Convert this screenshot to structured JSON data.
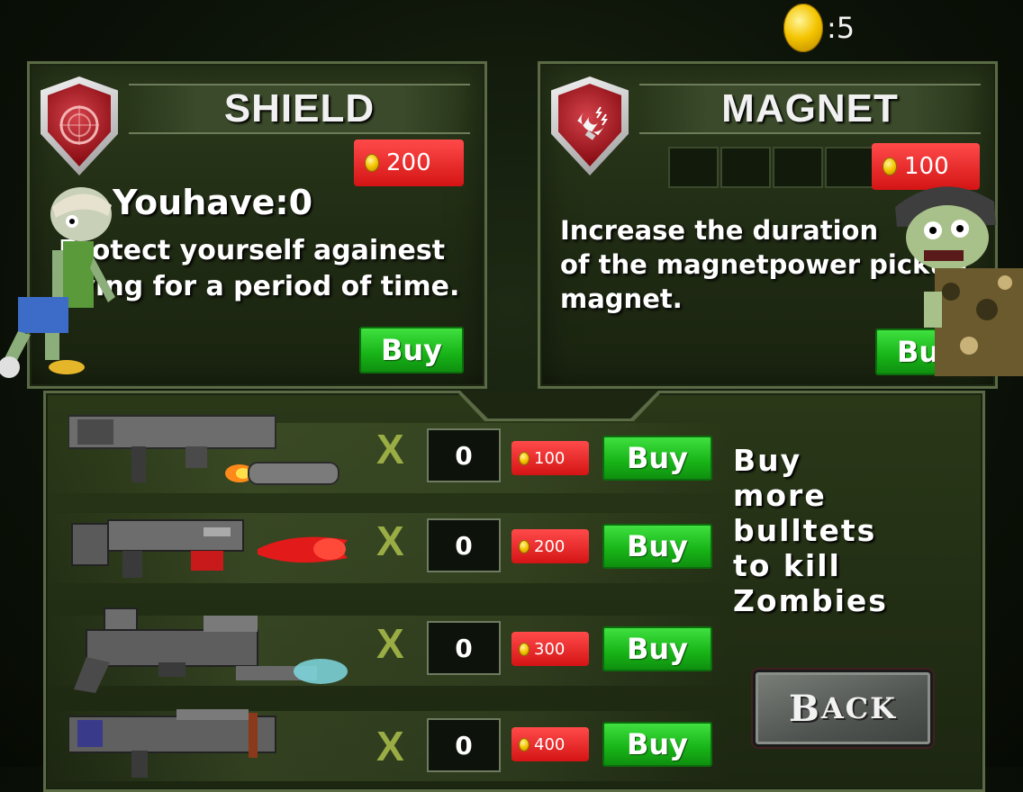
{
  "coins": {
    "count": ":5"
  },
  "shield": {
    "title": "SHIELD",
    "price": "200",
    "you_have": "Youhave:0",
    "description": "Protect yourself againest\ndying for a period of time.",
    "buy_label": "Buy"
  },
  "magnet": {
    "title": "MAGNET",
    "price": "100",
    "level_filled": 0,
    "level_total": 4,
    "description": "Increase the duration\nof the magnetpower pickup\nmagnet.",
    "buy_label": "Buy"
  },
  "weapons": [
    {
      "x": "X",
      "qty": "0",
      "price": "100",
      "buy_label": "Buy"
    },
    {
      "x": "X",
      "qty": "0",
      "price": "200",
      "buy_label": "Buy"
    },
    {
      "x": "X",
      "qty": "0",
      "price": "300",
      "buy_label": "Buy"
    },
    {
      "x": "X",
      "qty": "0",
      "price": "400",
      "buy_label": "Buy"
    }
  ],
  "side_text": "Buy\nmore\nbulltets\nto kill\nZombies",
  "back": {
    "first": "B",
    "rest": "ACK"
  },
  "colors": {
    "buy_green": "#17b317",
    "price_red": "#d41414",
    "coin_gold": "#f4c400",
    "x_mark": "#9aad44"
  }
}
